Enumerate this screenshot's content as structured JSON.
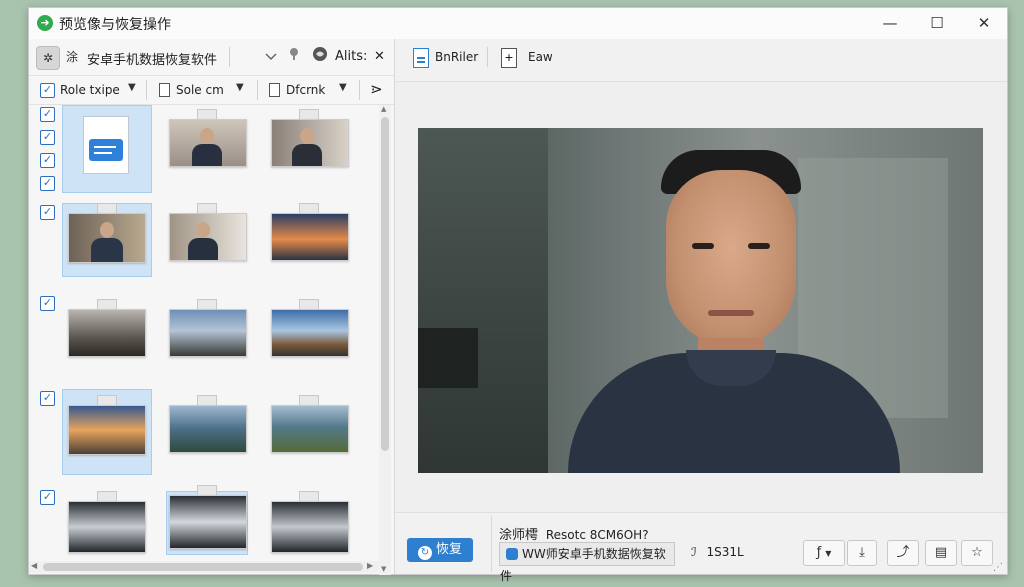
{
  "window": {
    "title": "预览像与恢复操作",
    "controls": {
      "minimize": "—",
      "maximize": "☐",
      "close": "✕"
    }
  },
  "left_toolbar": {
    "tool_icon_glyph": "✲",
    "mode_glyph": "涂",
    "app_name": "安卓手机数据恢复软件",
    "filter_label": "Alits:",
    "close_glyph": "✕"
  },
  "filters": [
    {
      "label": "Role txipe"
    },
    {
      "label": "Sole cm"
    },
    {
      "label": "Dfcrnk"
    }
  ],
  "right_toolbar": {
    "item1_label": "BnRiler",
    "item2_label": "Eaw"
  },
  "bottom": {
    "recover_label": "恢复",
    "file_label": "涂师樗",
    "file_name": "Resotc 8CM6OH?",
    "path_text": "WW师安卓手机数据恢复软件",
    "size_text": "1S31L",
    "size_glyph": "ℐ"
  },
  "grid": {
    "rows": [
      {
        "checked_count": 4,
        "thumbs": [
          "doc",
          "office-man",
          "office-man-2"
        ]
      },
      {
        "checked_count": 1,
        "thumbs": [
          "man-portrait",
          "man-office-3",
          "sunset-mountains"
        ]
      },
      {
        "checked_count": 1,
        "thumbs": [
          "office-room",
          "road-landscape",
          "sky-landscape"
        ]
      },
      {
        "checked_count": 1,
        "thumbs": [
          "road-sunset",
          "coast-cliffs",
          "coast-green"
        ]
      },
      {
        "checked_count": 1,
        "thumbs": [
          "water-splash",
          "water-splash-2",
          "water-splash-3"
        ]
      }
    ],
    "selected_cells": [
      "0-0",
      "1-0",
      "3-0",
      "4-1"
    ]
  }
}
